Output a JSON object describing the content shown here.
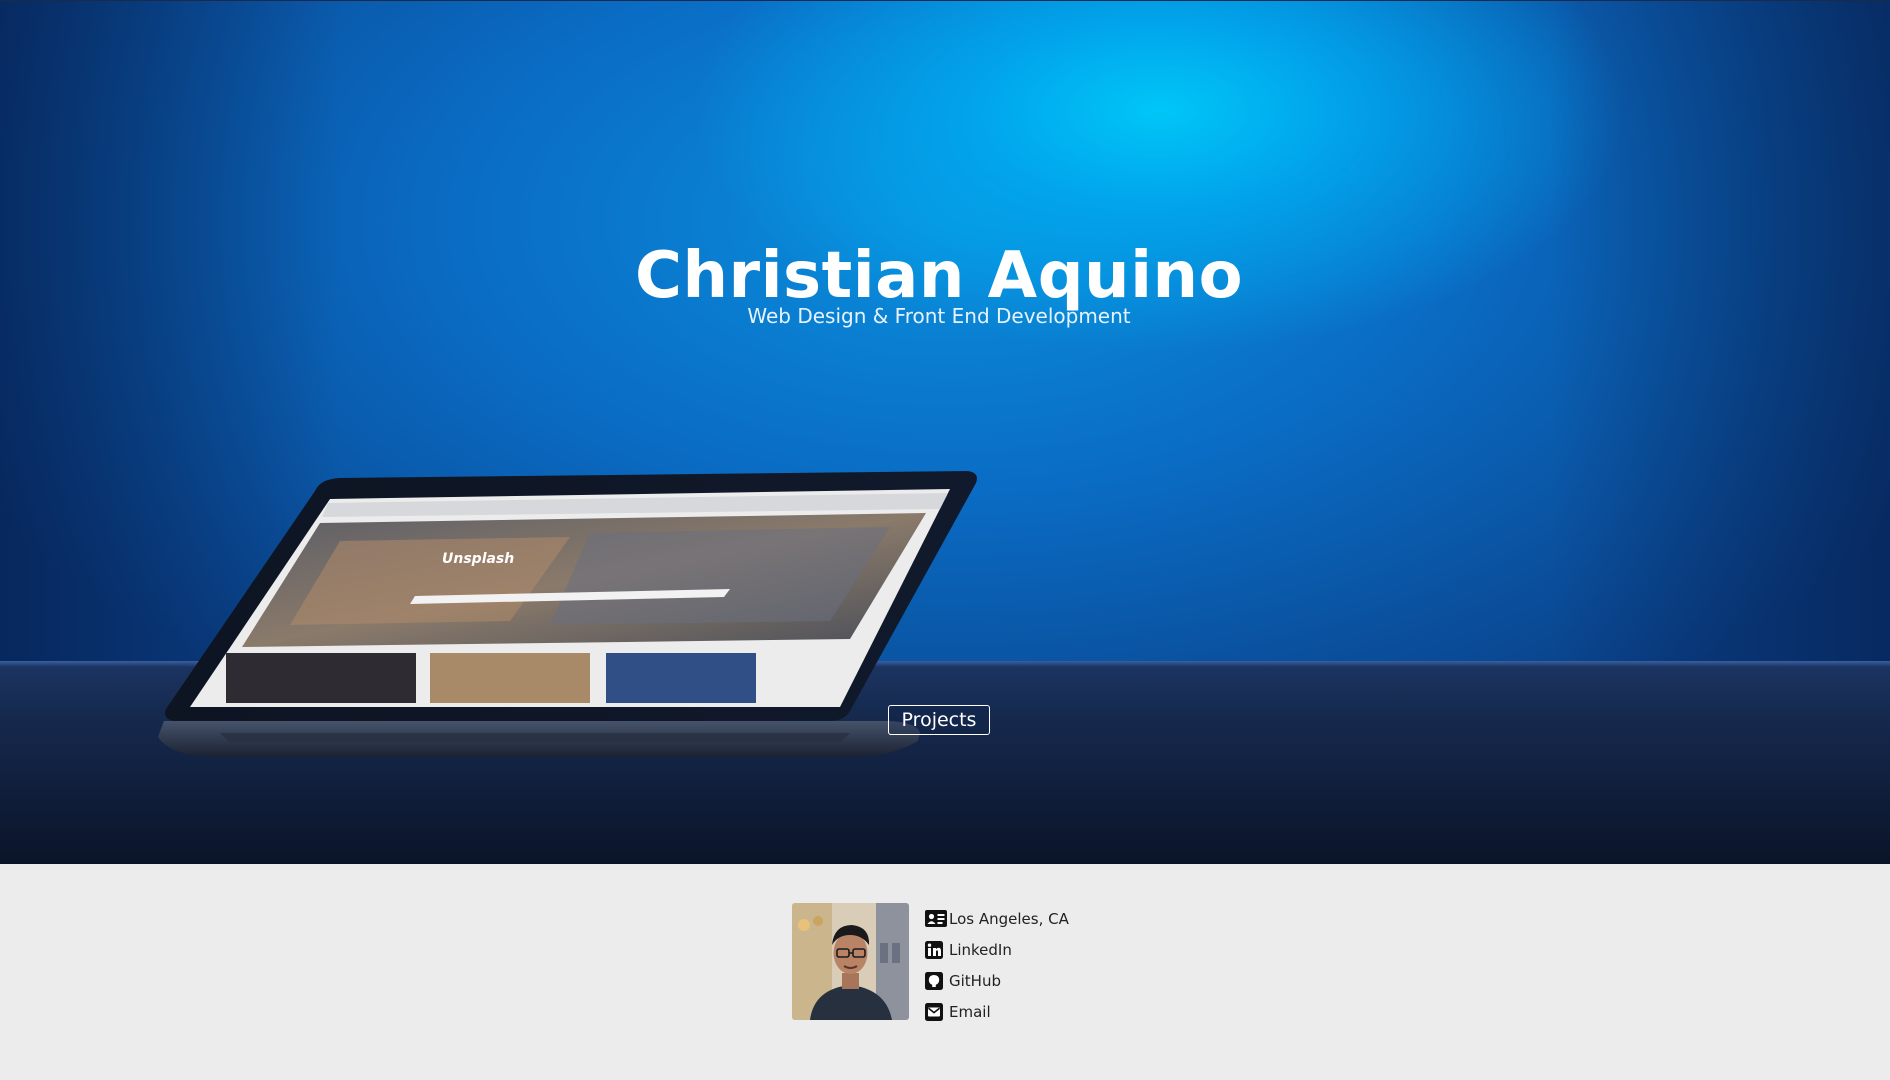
{
  "hero": {
    "title": "Christian Aquino",
    "subtitle": "Web Design & Front End Development",
    "projects_label": "Projects",
    "screen_brand": "Unsplash"
  },
  "contact": {
    "items": [
      {
        "label": "Los Angeles, CA",
        "icon": "address-card-icon"
      },
      {
        "label": "LinkedIn",
        "icon": "linkedin-icon"
      },
      {
        "label": "GitHub",
        "icon": "github-icon"
      },
      {
        "label": "Email",
        "icon": "envelope-icon"
      }
    ]
  },
  "colors": {
    "hero_glow": "#00c6f7",
    "hero_blue": "#0a6cc4",
    "footer_bg": "#ececec",
    "text_dark": "#222222"
  }
}
